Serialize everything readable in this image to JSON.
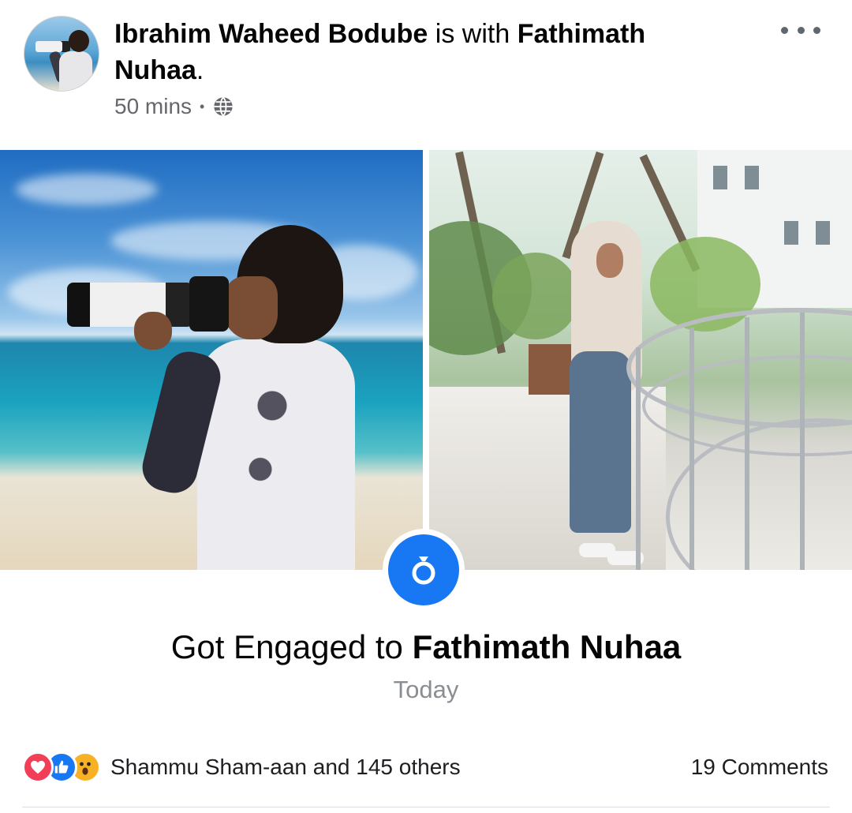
{
  "post": {
    "author": "Ibrahim Waheed Bodube",
    "with_text": " is with ",
    "tagged": "Fathimath Nuhaa",
    "period": ".",
    "time": "50 mins",
    "separator": "•",
    "privacy_icon": "globe-icon",
    "more_icon": "more-options-icon"
  },
  "life_event": {
    "icon": "ring-icon",
    "title_prefix": "Got Engaged to ",
    "title_name": "Fathimath Nuhaa",
    "date": "Today"
  },
  "footer": {
    "reaction_icons": [
      "love-reaction-icon",
      "like-reaction-icon",
      "wow-reaction-icon"
    ],
    "reactors": "Shammu Sham-aan and 145 others",
    "comments": "19 Comments"
  },
  "colors": {
    "accent": "#1877f2",
    "love": "#f33e58",
    "wow": "#f7b125",
    "secondary_text": "#65676b"
  }
}
